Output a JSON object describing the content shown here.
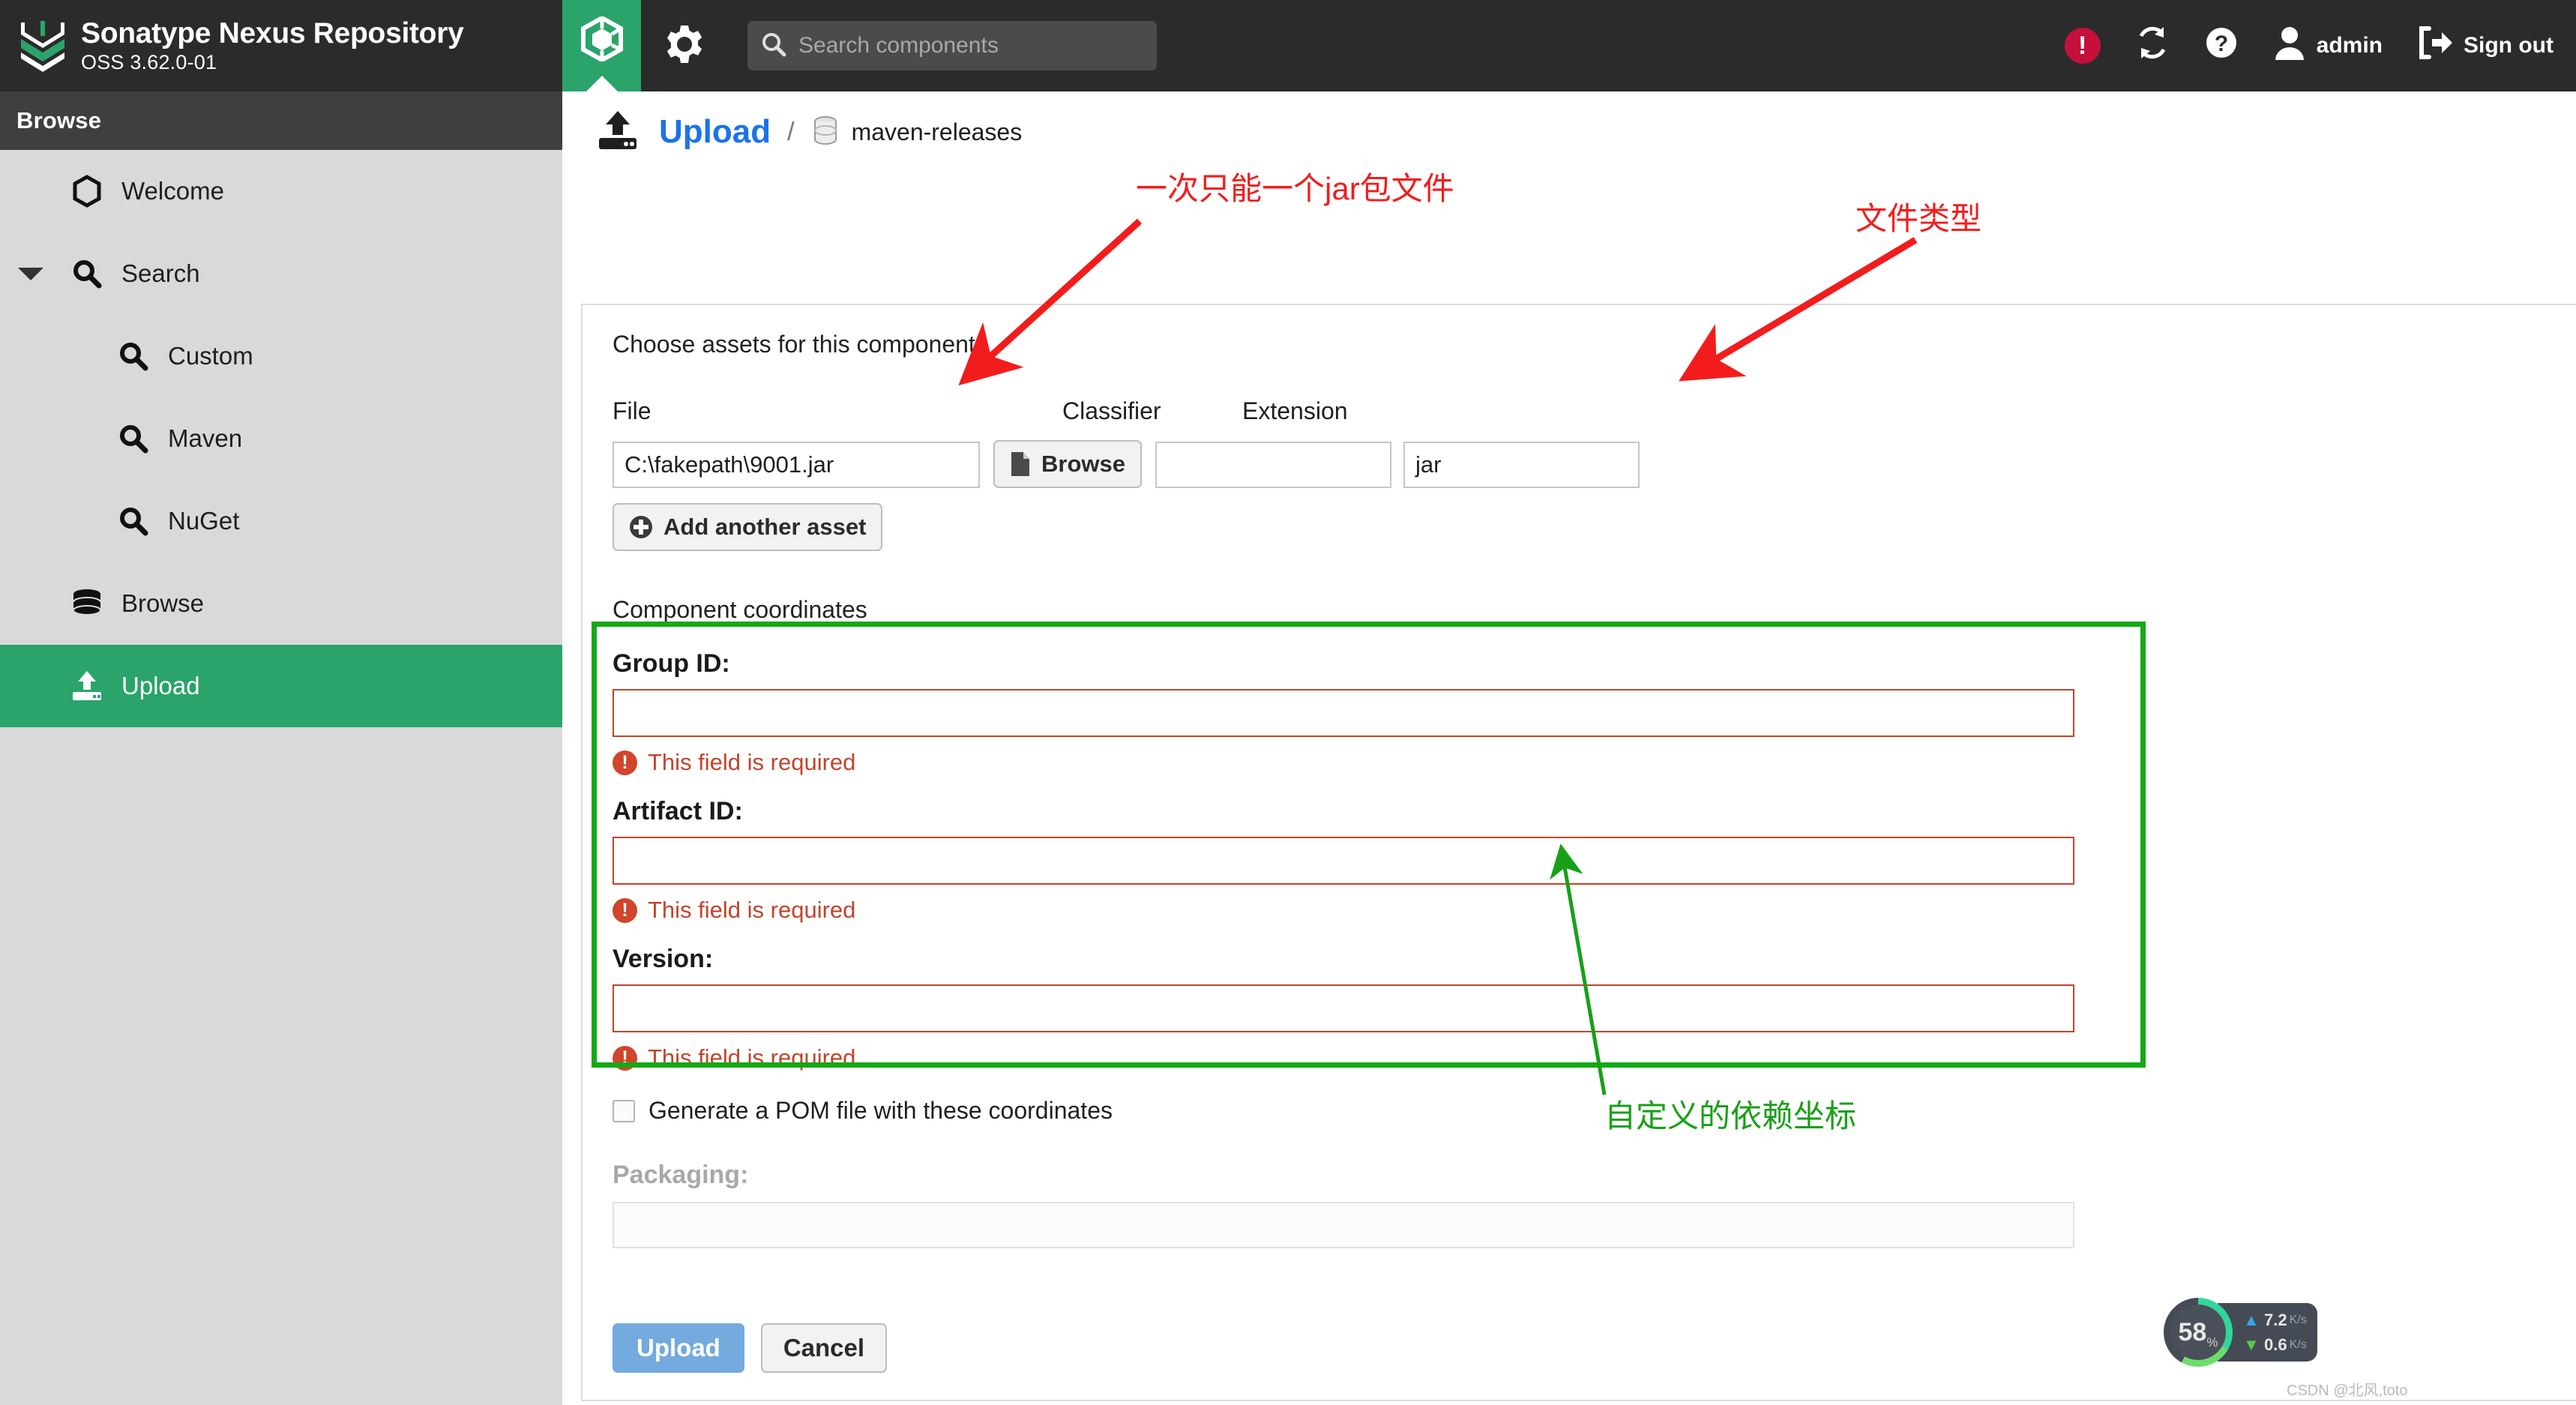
{
  "brand": {
    "title": "Sonatype Nexus Repository",
    "subtitle": "OSS 3.62.0-01",
    "logo_icon": "nexus-chevron-logo"
  },
  "topbar": {
    "browse_tab_icon": "cube-icon",
    "settings_icon": "gear-icon",
    "search": {
      "placeholder": "Search components",
      "value": "",
      "icon": "search-icon"
    },
    "alert": {
      "icon": "alert-exclamation-icon",
      "glyph": "!"
    },
    "refresh_icon": "refresh-sync-icon",
    "help_icon": "question-circle-icon",
    "user": {
      "icon": "user-avatar-icon",
      "label": "admin"
    },
    "signout": {
      "icon": "sign-out-icon",
      "label": "Sign out"
    }
  },
  "sidebar": {
    "header": "Browse",
    "items": [
      {
        "label": "Welcome",
        "icon": "hexagon-icon",
        "level": 1,
        "active": false,
        "caret": false
      },
      {
        "label": "Search",
        "icon": "search-icon",
        "level": 1,
        "active": false,
        "caret": true
      },
      {
        "label": "Custom",
        "icon": "search-icon",
        "level": 2,
        "active": false,
        "caret": false
      },
      {
        "label": "Maven",
        "icon": "search-icon",
        "level": 2,
        "active": false,
        "caret": false
      },
      {
        "label": "NuGet",
        "icon": "search-icon",
        "level": 2,
        "active": false,
        "caret": false
      },
      {
        "label": "Browse",
        "icon": "database-icon",
        "level": 1,
        "active": false,
        "caret": false
      },
      {
        "label": "Upload",
        "icon": "upload-icon",
        "level": 1,
        "active": true,
        "caret": false
      }
    ]
  },
  "breadcrumb": {
    "icon": "upload-icon",
    "page": "Upload",
    "separator": "/",
    "repo_icon": "database-icon",
    "repo": "maven-releases"
  },
  "form": {
    "assets_section_title": "Choose assets for this component",
    "labels": {
      "file": "File",
      "classifier": "Classifier",
      "extension": "Extension"
    },
    "file_value": "C:\\fakepath\\9001.jar",
    "browse_button": {
      "label": "Browse",
      "icon": "file-icon"
    },
    "classifier_value": "",
    "extension_value": "jar",
    "add_asset_button": {
      "label": "Add another asset",
      "icon": "plus-circle-icon"
    },
    "coordinates_section_title": "Component coordinates",
    "coordinates": [
      {
        "label": "Group ID:",
        "value": "",
        "error": "This field is required"
      },
      {
        "label": "Artifact ID:",
        "value": "",
        "error": "This field is required"
      },
      {
        "label": "Version:",
        "value": "",
        "error": "This field is required"
      }
    ],
    "generate_pom": {
      "label": "Generate a POM file with these coordinates",
      "checked": false
    },
    "packaging": {
      "label": "Packaging:",
      "value": "",
      "disabled": true
    },
    "upload_button": "Upload",
    "cancel_button": "Cancel"
  },
  "annotations": [
    {
      "text": "一次只能一个jar包文件",
      "color": "#f31c1c"
    },
    {
      "text": "文件类型",
      "color": "#f31c1c"
    },
    {
      "text": "自定义的依赖坐标",
      "color": "#18a018"
    }
  ],
  "net_widget": {
    "cpu_percent": "58",
    "percent_symbol": "%",
    "upload": {
      "arrow": "▲",
      "value": "7.2",
      "unit": "K/s"
    },
    "download": {
      "arrow": "▼",
      "value": "0.6",
      "unit": "K/s"
    }
  },
  "watermark": "CSDN @北风,toto"
}
